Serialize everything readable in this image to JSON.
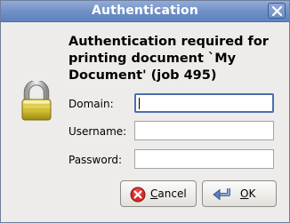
{
  "window": {
    "title": "Authentication"
  },
  "dialog": {
    "heading": "Authentication required for printing document `My Document' (job 495)"
  },
  "fields": {
    "domain_label": "Domain:",
    "domain_value": "",
    "username_label": "Username:",
    "username_value": "",
    "password_label": "Password:",
    "password_value": ""
  },
  "buttons": {
    "cancel_mnemonic": "C",
    "cancel_rest": "ancel",
    "ok_mnemonic": "O",
    "ok_rest": "K"
  },
  "icons": {
    "close": "close-icon",
    "lock": "padlock-icon",
    "cancel": "cancel-icon",
    "ok": "ok-icon"
  },
  "colors": {
    "titlebar": "#6e8fc6",
    "background": "#edecea",
    "focus": "#4a6fae",
    "cancel_icon": "#cc2222"
  }
}
